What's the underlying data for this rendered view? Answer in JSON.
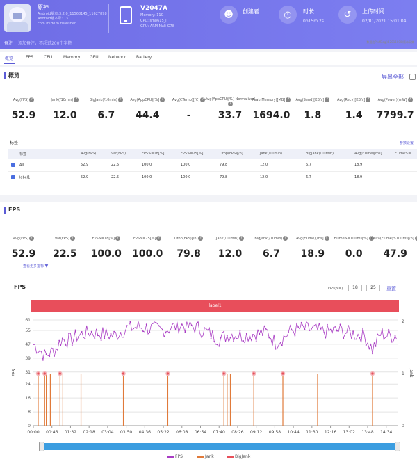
{
  "header": {
    "app_name": "原神",
    "app_sub_lines": [
      "Android版本:3.2.0_11568145_11627898",
      "Android版本号: 131",
      "com.miHoYo.Yuanshen"
    ],
    "note_label": "备注",
    "note_text": "添加备注，不超过200个字符",
    "device_name": "V2047A",
    "device_lines": [
      "Memory: 11G",
      "CPU: sm8615_i",
      "GPU: ARM Mali-G78"
    ],
    "creator_label": "创建者",
    "duration_label": "时长",
    "duration_value": "0h15m 2s",
    "upload_label": "上传时间",
    "upload_value": "02/01/2021 15:01:04",
    "version_text": "数据由PerfDog(4.2011000)版本采集"
  },
  "tabs": [
    "概览",
    "FPS",
    "CPU",
    "Memory",
    "GPU",
    "Network",
    "Battery"
  ],
  "overview": {
    "title": "概览",
    "export_label": "导出全部",
    "stats": [
      {
        "label": "Avg(FPS)",
        "value": "52.9"
      },
      {
        "label": "Jank(/10min)",
        "value": "12.0"
      },
      {
        "label": "BigJank(/10min)",
        "value": "6.7"
      },
      {
        "label": "Avg(AppCPU)[%]",
        "value": "44.4"
      },
      {
        "label": "Avg(CTemp)[℃]",
        "value": "-"
      },
      {
        "label": "Avg(AppCPU)[%] Normalized",
        "value": "33.7"
      },
      {
        "label": "Peak(Memory)[MB]",
        "value": "1694.0"
      },
      {
        "label": "Avg(Send)[KB/s]",
        "value": "1.8"
      },
      {
        "label": "Avg(Recv)[KB/s]",
        "value": "1.4"
      },
      {
        "label": "Avg(Power)[mW]",
        "value": "7799.7"
      }
    ],
    "tag_label": "标签",
    "param_link": "参数设置",
    "table": {
      "headers": [
        "标签",
        "Avg(FPS)",
        "Var(FPS)",
        "FPS>=18[%]",
        "FPS>=25[%]",
        "Drop(FPS)[/h]",
        "Jank(/10min)",
        "BigJank(/10min)",
        "Avg(FTime)[ms]",
        "FTime>=..."
      ],
      "rows": [
        [
          "All",
          "52.9",
          "22.5",
          "100.0",
          "100.0",
          "79.8",
          "12.0",
          "6.7",
          "18.9",
          ""
        ],
        [
          "label1",
          "52.9",
          "22.5",
          "100.0",
          "100.0",
          "79.8",
          "12.0",
          "6.7",
          "18.9",
          ""
        ]
      ]
    }
  },
  "fps_section": {
    "title": "FPS",
    "stats": [
      {
        "label": "Avg(FPS)",
        "value": "52.9"
      },
      {
        "label": "Var(FPS)",
        "value": "22.5"
      },
      {
        "label": "FPS>=18[%]",
        "value": "100.0"
      },
      {
        "label": "FPS>=25[%]",
        "value": "100.0"
      },
      {
        "label": "Drop(FPS)[/h]",
        "value": "79.8"
      },
      {
        "label": "Jank(/10min)",
        "value": "12.0"
      },
      {
        "label": "BigJank(/10min)",
        "value": "6.7"
      },
      {
        "label": "Avg(FTime)[ms]",
        "value": "18.9"
      },
      {
        "label": "FTime>=100ms[%]",
        "value": "0.0"
      },
      {
        "label": "Delta(FTime)>100ms[/h]",
        "value": "47.9"
      }
    ],
    "more_link": "查看更多指标",
    "range_label": "FPS(>=)",
    "range_values": [
      "18",
      "25"
    ],
    "reset_label": "重置",
    "label_band": "label1"
  },
  "chart_data": {
    "type": "line",
    "title": "FPS",
    "ylabel": "FPS",
    "y2label": "Jank",
    "yticks": [
      0,
      8,
      16,
      24,
      31,
      39,
      47,
      55,
      61
    ],
    "y2ticks": [
      0,
      1,
      2
    ],
    "ylim": [
      0,
      61
    ],
    "y2lim": [
      0,
      2
    ],
    "xticks": [
      "00:00",
      "00:46",
      "01:32",
      "02:18",
      "03:04",
      "03:50",
      "04:36",
      "05:22",
      "06:08",
      "06:54",
      "07:40",
      "08:26",
      "09:12",
      "09:58",
      "10:44",
      "11:30",
      "12:16",
      "13:02",
      "13:48",
      "14:34"
    ],
    "x_range_seconds": [
      0,
      902
    ],
    "fps_keypoints": [
      [
        0,
        47
      ],
      [
        15,
        44
      ],
      [
        30,
        40
      ],
      [
        40,
        42
      ],
      [
        55,
        44
      ],
      [
        70,
        50
      ],
      [
        90,
        49
      ],
      [
        110,
        52
      ],
      [
        140,
        54
      ],
      [
        170,
        53
      ],
      [
        200,
        52
      ],
      [
        230,
        56
      ],
      [
        260,
        57
      ],
      [
        290,
        56
      ],
      [
        320,
        55
      ],
      [
        360,
        58
      ],
      [
        400,
        57
      ],
      [
        430,
        54
      ],
      [
        460,
        50
      ],
      [
        490,
        53
      ],
      [
        520,
        52
      ],
      [
        550,
        53
      ],
      [
        580,
        54
      ],
      [
        600,
        48
      ],
      [
        620,
        51
      ],
      [
        640,
        55
      ],
      [
        670,
        56
      ],
      [
        700,
        55
      ],
      [
        730,
        54
      ],
      [
        760,
        55
      ],
      [
        790,
        53
      ],
      [
        820,
        52
      ],
      [
        840,
        44
      ],
      [
        860,
        53
      ],
      [
        880,
        52
      ],
      [
        902,
        52
      ]
    ],
    "jank_times": [
      12,
      28,
      32,
      42,
      66,
      73,
      118,
      223,
      333,
      472,
      480,
      488,
      546,
      618,
      704,
      840
    ],
    "bigjank_times": [
      12,
      28,
      66,
      223,
      333,
      472,
      546,
      618,
      840
    ],
    "legend": [
      "FPS",
      "Jank",
      "BigJank"
    ],
    "series_colors": {
      "fps": "#a93cc4",
      "jank": "#e07a3a",
      "bigjank": "#e8505a"
    }
  }
}
